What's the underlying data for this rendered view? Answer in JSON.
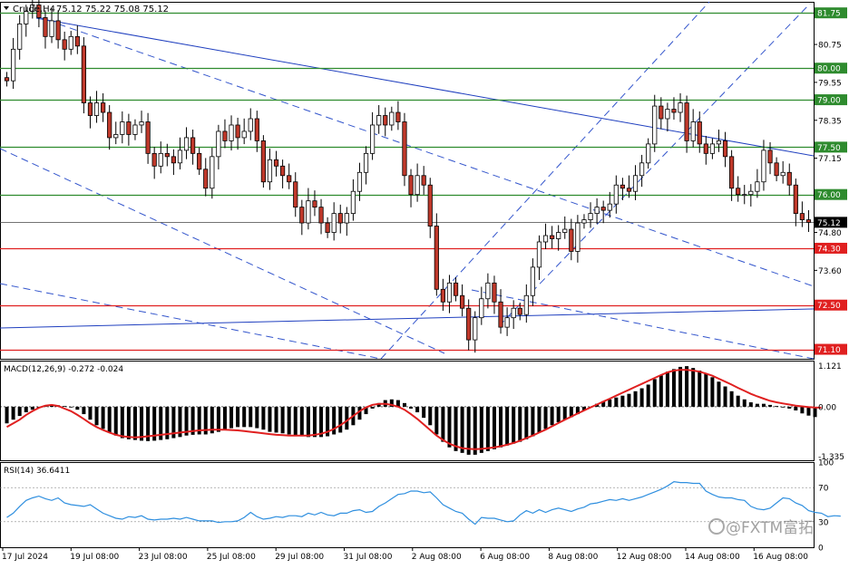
{
  "colors": {
    "bull": "#ffffff",
    "bear": "#c0392b",
    "candle_outline": "#000000",
    "support_resistance_green": "#2e8b2e",
    "support_red": "#e02020",
    "trendline_blue": "#1f3fbf",
    "channel_dashed": "#3355cc",
    "macd_signal": "#e02020",
    "macd_hist": "#000000",
    "rsi_line": "#2f8fdf",
    "grid_border": "#000000"
  },
  "header": {
    "dropdown_icon": "triangle-down-icon",
    "symbol": "Crude,H4",
    "ohlc": "75.12 75.22 75.08 75.12"
  },
  "chart_data": [
    {
      "type": "candlestick",
      "title": "Crude,H4",
      "price_axis_ticks": [
        "81.75",
        "80.75",
        "80.00",
        "79.55",
        "79.00",
        "78.35",
        "77.50",
        "77.15",
        "76.00",
        "75.12",
        "74.80",
        "74.30",
        "73.60",
        "72.50",
        "71.10"
      ],
      "ylim": [
        70.8,
        82.1
      ],
      "current_price": 75.12,
      "horizontal_levels": [
        {
          "label": "81.75",
          "value": 81.75,
          "color": "green"
        },
        {
          "label": "80.00",
          "value": 80.0,
          "color": "green"
        },
        {
          "label": "79.00",
          "value": 79.0,
          "color": "green"
        },
        {
          "label": "77.50",
          "value": 77.5,
          "color": "green"
        },
        {
          "label": "76.00",
          "value": 76.0,
          "color": "green"
        },
        {
          "label": "74.30",
          "value": 74.3,
          "color": "red"
        },
        {
          "label": "72.50",
          "value": 72.5,
          "color": "red"
        },
        {
          "label": "71.10",
          "value": 71.1,
          "color": "red"
        }
      ],
      "x_axis_labels": [
        "17 Jul 2024",
        "19 Jul 08:00",
        "23 Jul 08:00",
        "25 Jul 08:00",
        "29 Jul 08:00",
        "31 Jul 08:00",
        "2 Aug 08:00",
        "6 Aug 08:00",
        "8 Aug 08:00",
        "12 Aug 08:00",
        "14 Aug 08:00",
        "16 Aug 08:00"
      ],
      "candles_close": [
        79.6,
        80.6,
        81.4,
        81.8,
        82.0,
        81.6,
        81.0,
        81.5,
        80.9,
        80.6,
        81.0,
        80.7,
        78.9,
        78.5,
        78.9,
        78.6,
        77.8,
        77.9,
        78.3,
        77.9,
        78.2,
        78.3,
        77.3,
        76.9,
        77.3,
        77.2,
        77.0,
        77.4,
        77.8,
        77.3,
        76.8,
        76.2,
        77.2,
        78.0,
        77.7,
        78.2,
        77.8,
        78.0,
        78.4,
        77.7,
        76.4,
        77.1,
        76.9,
        76.6,
        76.4,
        75.6,
        75.1,
        75.8,
        75.6,
        75.1,
        74.8,
        75.4,
        75.1,
        75.4,
        76.1,
        76.7,
        77.3,
        78.2,
        78.5,
        78.2,
        78.6,
        78.3,
        76.6,
        76.0,
        76.6,
        76.3,
        75.0,
        73.0,
        72.6,
        73.2,
        72.8,
        72.4,
        71.4,
        72.1,
        72.7,
        73.2,
        72.6,
        71.8,
        72.1,
        72.4,
        72.2,
        72.8,
        73.7,
        74.5,
        74.7,
        74.6,
        74.8,
        74.9,
        74.2,
        75.1,
        75.2,
        75.4,
        75.6,
        75.5,
        75.7,
        76.3,
        76.2,
        76.1,
        76.6,
        77.0,
        77.6,
        78.8,
        78.4,
        78.7,
        78.6,
        78.9,
        77.7,
        78.3,
        77.6,
        77.3,
        77.6,
        77.7,
        77.2,
        76.2,
        76.0,
        76.0,
        76.1,
        76.4,
        77.4,
        77.0,
        76.6,
        76.7,
        76.3,
        75.4,
        75.2,
        75.12
      ],
      "candles_open": [
        79.7,
        79.6,
        80.6,
        81.4,
        81.8,
        82.0,
        81.6,
        81.0,
        81.5,
        80.9,
        80.6,
        81.0,
        80.7,
        78.9,
        78.5,
        78.9,
        78.6,
        77.8,
        77.9,
        78.3,
        77.9,
        78.2,
        78.3,
        77.3,
        76.9,
        77.3,
        77.2,
        77.0,
        77.4,
        77.8,
        77.3,
        76.8,
        76.2,
        77.2,
        78.0,
        77.7,
        78.2,
        77.8,
        78.0,
        78.4,
        77.7,
        76.4,
        77.1,
        76.9,
        76.6,
        76.4,
        75.6,
        75.1,
        75.8,
        75.6,
        75.1,
        74.8,
        75.4,
        75.1,
        75.4,
        76.1,
        76.7,
        77.3,
        78.2,
        78.5,
        78.2,
        78.6,
        78.3,
        76.6,
        76.0,
        76.6,
        76.3,
        75.0,
        73.0,
        72.6,
        73.2,
        72.8,
        72.4,
        71.4,
        72.1,
        72.7,
        73.2,
        72.6,
        71.8,
        72.1,
        72.4,
        72.2,
        72.8,
        73.7,
        74.5,
        74.7,
        74.6,
        74.8,
        74.9,
        74.2,
        75.1,
        75.2,
        75.4,
        75.6,
        75.5,
        75.7,
        76.3,
        76.2,
        76.1,
        76.6,
        77.0,
        77.6,
        78.8,
        78.4,
        78.7,
        78.6,
        78.9,
        77.7,
        78.3,
        77.6,
        77.3,
        77.6,
        77.7,
        77.2,
        76.2,
        76.0,
        76.0,
        76.1,
        76.4,
        77.4,
        77.0,
        76.6,
        76.7,
        76.3,
        75.4,
        75.2
      ]
    },
    {
      "type": "histogram",
      "title": "MACD(12,26,9) -0.272 -0.024",
      "axis_ticks": [
        "1.121",
        "0.00",
        "-1.335"
      ],
      "ylim": [
        -1.45,
        1.25
      ],
      "histogram": [
        -0.45,
        -0.35,
        -0.25,
        -0.15,
        -0.08,
        -0.03,
        0.02,
        0.05,
        0.04,
        0.02,
        -0.02,
        -0.08,
        -0.2,
        -0.35,
        -0.5,
        -0.6,
        -0.7,
        -0.78,
        -0.85,
        -0.88,
        -0.9,
        -0.92,
        -0.93,
        -0.92,
        -0.9,
        -0.88,
        -0.85,
        -0.82,
        -0.78,
        -0.76,
        -0.75,
        -0.75,
        -0.72,
        -0.68,
        -0.62,
        -0.58,
        -0.55,
        -0.55,
        -0.55,
        -0.58,
        -0.62,
        -0.68,
        -0.7,
        -0.72,
        -0.75,
        -0.78,
        -0.8,
        -0.82,
        -0.82,
        -0.82,
        -0.8,
        -0.75,
        -0.7,
        -0.62,
        -0.5,
        -0.35,
        -0.2,
        -0.05,
        0.1,
        0.18,
        0.2,
        0.18,
        0.1,
        -0.05,
        -0.15,
        -0.3,
        -0.5,
        -0.75,
        -0.95,
        -1.1,
        -1.2,
        -1.25,
        -1.3,
        -1.3,
        -1.25,
        -1.2,
        -1.15,
        -1.1,
        -1.05,
        -1.0,
        -0.95,
        -0.88,
        -0.8,
        -0.7,
        -0.6,
        -0.5,
        -0.42,
        -0.35,
        -0.28,
        -0.2,
        -0.1,
        0.0,
        0.08,
        0.15,
        0.2,
        0.25,
        0.3,
        0.35,
        0.42,
        0.5,
        0.6,
        0.75,
        0.85,
        0.95,
        1.02,
        1.08,
        1.1,
        1.05,
        0.98,
        0.9,
        0.8,
        0.68,
        0.55,
        0.42,
        0.3,
        0.2,
        0.12,
        0.08,
        0.08,
        0.05,
        0.02,
        -0.02,
        -0.05,
        -0.1,
        -0.18,
        -0.24,
        -0.28
      ],
      "signal": [
        -0.55,
        -0.45,
        -0.35,
        -0.22,
        -0.12,
        -0.03,
        0.03,
        0.05,
        0.02,
        -0.05,
        -0.12,
        -0.22,
        -0.33,
        -0.45,
        -0.55,
        -0.63,
        -0.7,
        -0.76,
        -0.8,
        -0.82,
        -0.83,
        -0.82,
        -0.8,
        -0.78,
        -0.76,
        -0.74,
        -0.72,
        -0.7,
        -0.68,
        -0.66,
        -0.64,
        -0.63,
        -0.62,
        -0.62,
        -0.62,
        -0.63,
        -0.64,
        -0.66,
        -0.68,
        -0.7,
        -0.72,
        -0.74,
        -0.76,
        -0.77,
        -0.78,
        -0.78,
        -0.78,
        -0.78,
        -0.76,
        -0.73,
        -0.68,
        -0.6,
        -0.5,
        -0.38,
        -0.25,
        -0.12,
        -0.02,
        0.05,
        0.08,
        0.08,
        0.05,
        0.0,
        -0.08,
        -0.2,
        -0.33,
        -0.48,
        -0.63,
        -0.78,
        -0.9,
        -1.0,
        -1.07,
        -1.12,
        -1.14,
        -1.15,
        -1.14,
        -1.12,
        -1.1,
        -1.07,
        -1.03,
        -0.98,
        -0.92,
        -0.85,
        -0.78,
        -0.7,
        -0.62,
        -0.53,
        -0.44,
        -0.35,
        -0.27,
        -0.18,
        -0.1,
        -0.02,
        0.06,
        0.14,
        0.22,
        0.3,
        0.38,
        0.46,
        0.54,
        0.62,
        0.7,
        0.78,
        0.86,
        0.93,
        0.98,
        1.0,
        1.0,
        0.98,
        0.95,
        0.9,
        0.84,
        0.76,
        0.68,
        0.6,
        0.51,
        0.43,
        0.35,
        0.28,
        0.22,
        0.16,
        0.12,
        0.09,
        0.06,
        0.03,
        0.01,
        -0.01,
        -0.02,
        -0.024
      ]
    },
    {
      "type": "line",
      "title": "RSI(14) 36.6411",
      "axis_ticks": [
        "100",
        "70",
        "30",
        "0"
      ],
      "ylim": [
        0,
        100
      ],
      "levels": [
        70,
        30
      ],
      "values": [
        35,
        40,
        48,
        55,
        58,
        60,
        57,
        55,
        58,
        52,
        50,
        49,
        48,
        50,
        45,
        40,
        37,
        34,
        33,
        36,
        35,
        37,
        33,
        32,
        33,
        33,
        34,
        33,
        35,
        33,
        31,
        31,
        31,
        29,
        30,
        30,
        31,
        35,
        41,
        36,
        33,
        34,
        36,
        35,
        37,
        37,
        36,
        40,
        38,
        41,
        38,
        37,
        40,
        40,
        43,
        44,
        41,
        42,
        48,
        52,
        57,
        62,
        63,
        66,
        66,
        64,
        65,
        58,
        50,
        46,
        42,
        40,
        33,
        27,
        35,
        34,
        34,
        32,
        30,
        31,
        38,
        43,
        40,
        44,
        41,
        44,
        46,
        44,
        42,
        45,
        47,
        51,
        52,
        54,
        56,
        55,
        57,
        55,
        57,
        59,
        62,
        65,
        68,
        72,
        77,
        76,
        76,
        75,
        75,
        66,
        62,
        59,
        58,
        58,
        56,
        55,
        48,
        45,
        44,
        46,
        52,
        58,
        57,
        52,
        49,
        43,
        41,
        40,
        36,
        37,
        36.6
      ]
    }
  ],
  "watermark": {
    "text": "@FXTM富拓"
  }
}
